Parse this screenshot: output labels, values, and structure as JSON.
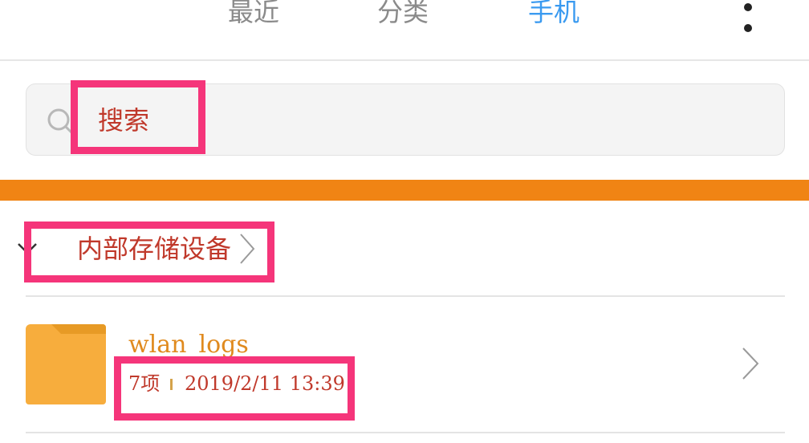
{
  "tabs": [
    {
      "label": "最近",
      "active": false
    },
    {
      "label": "分类",
      "active": false
    },
    {
      "label": "手机",
      "active": true
    }
  ],
  "more_icon": "more-vertical-icon",
  "search": {
    "label": "搜索",
    "icon": "search-icon"
  },
  "breadcrumb": {
    "label": "内部存储设备",
    "icons": [
      "chevron-down-icon",
      "chevron-right-icon"
    ]
  },
  "files": [
    {
      "name": "wlan_logs",
      "count": "7项",
      "date": "2019/2/11 13:39",
      "icon": "folder-icon"
    }
  ],
  "colors": {
    "tab_active": "#3a9af0",
    "tab_inactive": "#8a8a8a",
    "accent_bar": "#f08414",
    "folder": "#f7ad3d",
    "highlight": "#f5357a",
    "annotation_text": "#c0392b",
    "file_name": "#e08a1e"
  }
}
